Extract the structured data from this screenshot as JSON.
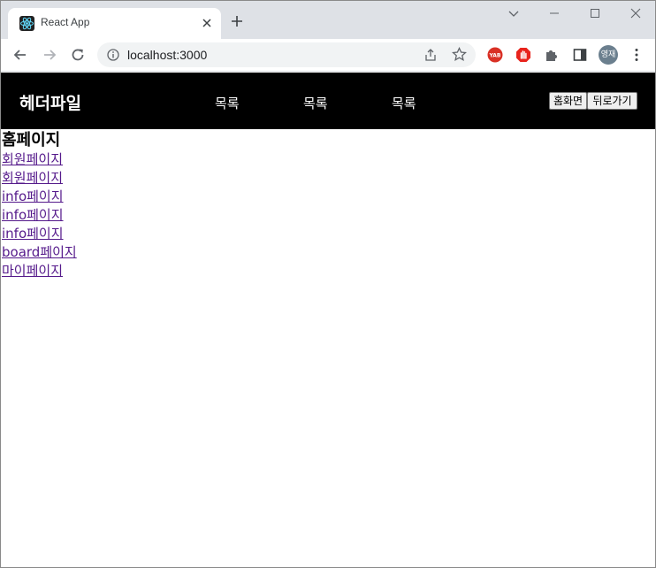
{
  "browser": {
    "tab_title": "React App",
    "url": "localhost:3000",
    "profile_initials": "영재",
    "extensions": [
      "yab-extension-icon",
      "adblock-hand-icon",
      "puzzle-extensions-icon",
      "side-panel-icon"
    ],
    "accent": "#1a73e8"
  },
  "app": {
    "logo": "헤더파일",
    "nav": [
      {
        "label": "목록"
      },
      {
        "label": "목록"
      },
      {
        "label": "목록"
      }
    ],
    "buttons": {
      "home": "홈화면",
      "back": "뒤로가기"
    },
    "heading": "홈페이지",
    "links": [
      {
        "label": "회원페이지"
      },
      {
        "label": "회원페이지"
      },
      {
        "label": "info페이지"
      },
      {
        "label": "info페이지"
      },
      {
        "label": "info페이지"
      },
      {
        "label": "board페이지"
      },
      {
        "label": "마이페이지"
      }
    ],
    "header_bg": "#000000",
    "link_color": "#551a8b"
  }
}
